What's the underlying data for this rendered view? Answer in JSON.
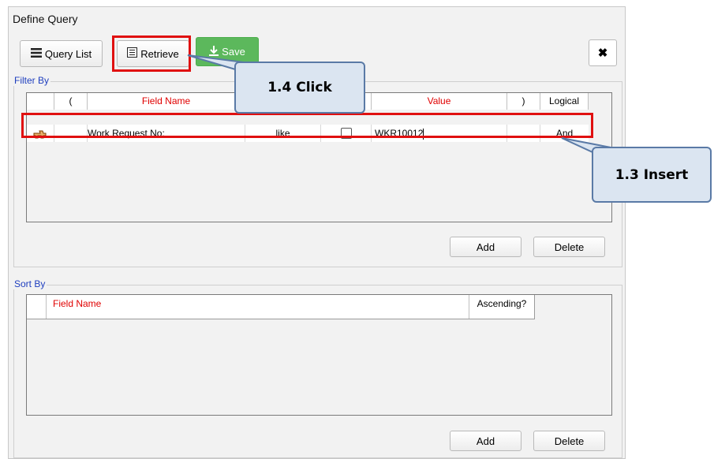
{
  "dialog": {
    "title": "Define Query",
    "close_symbol": "✖"
  },
  "toolbar": {
    "query_list_label": "Query List",
    "retrieve_label": "Retrieve",
    "save_label": "Save"
  },
  "filter": {
    "legend": "Filter By",
    "columns": {
      "open_paren": "(",
      "field_name": "Field Name",
      "value": "Value",
      "close_paren": ")",
      "logical": "Logical"
    },
    "row": {
      "field_name": "Work Request No:",
      "operator": "like",
      "value": "WKR10012",
      "logical": "And"
    },
    "add_label": "Add",
    "delete_label": "Delete"
  },
  "sort": {
    "legend": "Sort By",
    "columns": {
      "field_name": "Field Name",
      "ascending": "Ascending?"
    },
    "add_label": "Add",
    "delete_label": "Delete"
  },
  "annotations": {
    "click_label": "1.4 Click",
    "insert_label": "1.3 Insert"
  },
  "colors": {
    "highlight": "#e01010",
    "callout_fill": "#dbe5f1",
    "callout_border": "#5a7aa6",
    "save_green": "#5cb85c",
    "legend_blue": "#1f3fbf",
    "header_red": "#e00000"
  }
}
